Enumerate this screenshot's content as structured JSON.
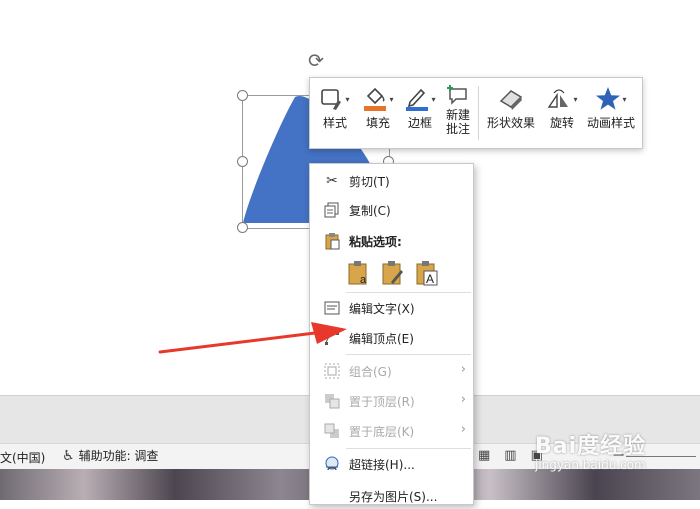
{
  "mini_toolbar": {
    "buttons": [
      {
        "label": "样式",
        "icon": "shape-style-icon"
      },
      {
        "label": "填充",
        "icon": "fill-bucket-icon"
      },
      {
        "label": "边框",
        "icon": "outline-pen-icon"
      },
      {
        "label": "新建\n批注",
        "icon": "new-comment-icon"
      },
      {
        "label": "形状效果",
        "icon": "shape-effects-icon"
      },
      {
        "label": "旋转",
        "icon": "rotate-icon"
      },
      {
        "label": "动画样式",
        "icon": "animation-star-icon"
      }
    ],
    "colors": {
      "fill_accent": "#e8732a",
      "outline_accent": "#2f6fd1",
      "star": "#2f63b8",
      "comment_plus": "#2a9a52"
    }
  },
  "context_menu": {
    "items": [
      {
        "label": "剪切(T)",
        "icon": "scissors-icon",
        "disabled": false
      },
      {
        "label": "复制(C)",
        "icon": "copy-icon",
        "disabled": false
      },
      {
        "label": "粘贴选项:",
        "icon": "paste-icon",
        "disabled": false
      },
      {
        "label": "编辑文字(X)",
        "icon": "edit-text-icon",
        "disabled": false
      },
      {
        "label": "编辑顶点(E)",
        "icon": "edit-points-icon",
        "disabled": false
      },
      {
        "label": "组合(G)",
        "icon": "group-icon",
        "disabled": true,
        "submenu": true
      },
      {
        "label": "置于顶层(R)",
        "icon": "bring-front-icon",
        "disabled": true,
        "submenu": true
      },
      {
        "label": "置于底层(K)",
        "icon": "send-back-icon",
        "disabled": true,
        "submenu": true
      },
      {
        "label": "超链接(H)...",
        "icon": "hyperlink-icon",
        "disabled": false
      },
      {
        "label": "另存为图片(S)...",
        "icon": "save-picture-icon",
        "disabled": false
      }
    ],
    "paste_options": [
      "paste-use-destination-theme-icon",
      "paste-keep-source-formatting-icon",
      "paste-keep-text-only-icon"
    ]
  },
  "status_bar": {
    "language": "文(中国)",
    "accessibility": "辅助功能: 调查"
  },
  "shape": {
    "fill_color": "#4472c4"
  },
  "annotation": {
    "arrow_color": "#e8382b"
  },
  "watermark": {
    "brand": "Bai度经验",
    "url": "jingyan.baidu.com"
  }
}
